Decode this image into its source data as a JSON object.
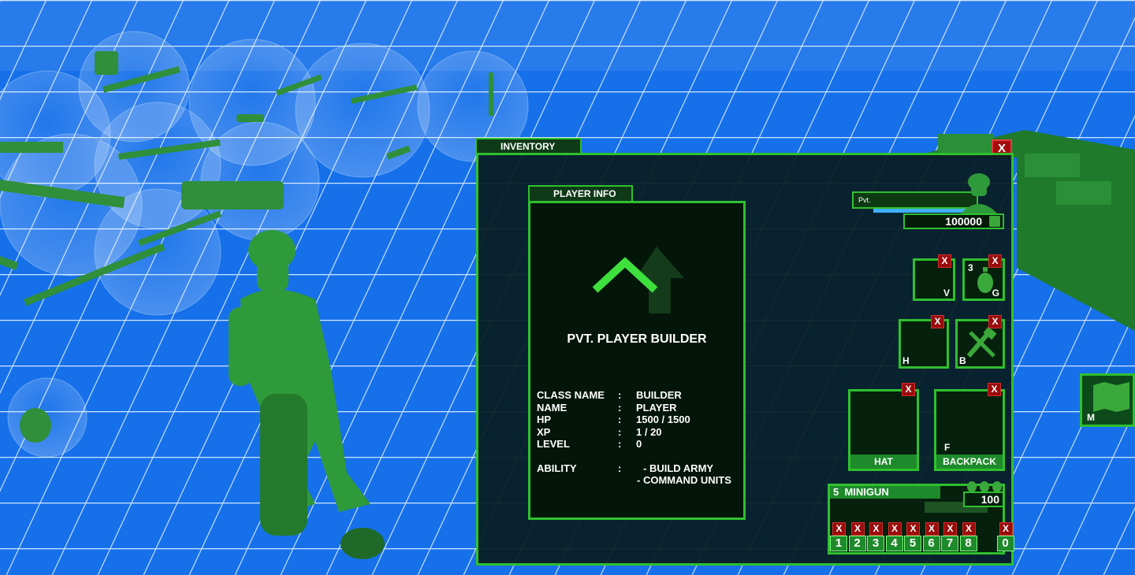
{
  "inventory": {
    "tab_label": "INVENTORY",
    "close_label": "X"
  },
  "player_info": {
    "tab_label": "PLAYER INFO",
    "title": "PVT.  PLAYER BUILDER",
    "stats": [
      {
        "key": "CLASS NAME",
        "sep": ":",
        "value": "BUILDER"
      },
      {
        "key": "NAME",
        "sep": ":",
        "value": "PLAYER"
      },
      {
        "key": "HP",
        "sep": ":",
        "value": "1500 / 1500"
      },
      {
        "key": "XP",
        "sep": ":",
        "value": "1 / 20"
      },
      {
        "key": "LEVEL",
        "sep": ":",
        "value": "0"
      }
    ],
    "ability": {
      "key": "ABILITY",
      "sep": ":",
      "lines": [
        "- BUILD ARMY",
        "- COMMAND UNITS"
      ]
    }
  },
  "status": {
    "rank_short": "Pvt.",
    "hp_fraction": 1.0,
    "money": "100000"
  },
  "equipment": {
    "v_key": "V",
    "g_key": "G",
    "g_count": "3",
    "h_key": "H",
    "b_key": "B",
    "hat_label": "HAT",
    "backpack_label": "BACKPACK",
    "backpack_key": "F",
    "remove_label": "X"
  },
  "weapon": {
    "slot": "5",
    "name": "MINIGUN",
    "ammo": "100"
  },
  "hotbar": [
    "1",
    "2",
    "3",
    "4",
    "5",
    "6",
    "7",
    "8",
    "",
    "0"
  ],
  "map_button": {
    "key": "M"
  },
  "colors": {
    "accent": "#2fc02f",
    "panel": "#081c20",
    "close": "#a50d0d",
    "sky": "#1f7cf0"
  }
}
